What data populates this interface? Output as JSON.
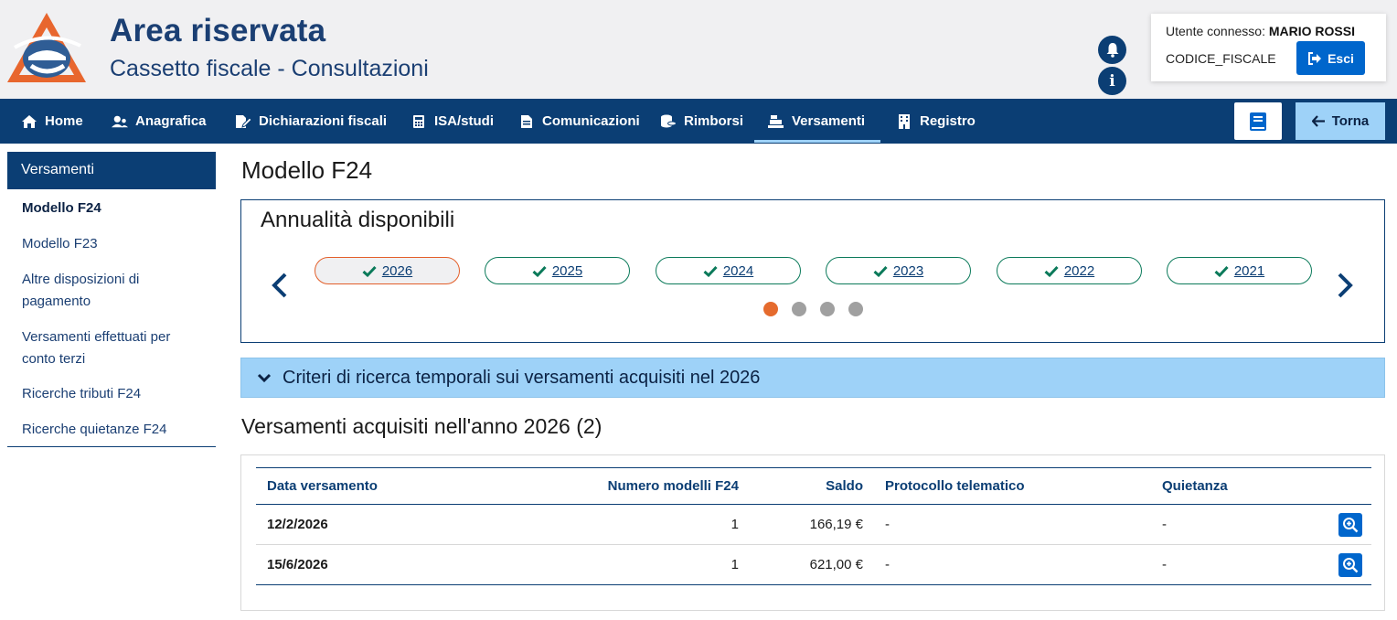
{
  "header": {
    "title": "Area riservata",
    "subtitle": "Cassetto fiscale - Consultazioni",
    "user_label": "Utente connesso:",
    "user_name": "MARIO ROSSI",
    "codice_fiscale": "CODICE_FISCALE",
    "logout_label": "Esci",
    "colors": {
      "brand_blue": "#0b3e74",
      "accent_orange": "#e35f2a",
      "button_blue": "#0066cc"
    }
  },
  "nav": {
    "items": [
      {
        "label": "Home",
        "icon": "home-icon"
      },
      {
        "label": "Anagrafica",
        "icon": "users-icon"
      },
      {
        "label": "Dichiarazioni fiscali",
        "icon": "edit-document-icon"
      },
      {
        "label": "ISA/studi",
        "icon": "calculator-icon"
      },
      {
        "label": "Comunicazioni",
        "icon": "document-icon"
      },
      {
        "label": "Rimborsi",
        "icon": "coins-icon"
      },
      {
        "label": "Versamenti",
        "icon": "cash-register-icon",
        "active": true
      },
      {
        "label": "Registro",
        "icon": "building-icon"
      }
    ],
    "manual_icon": "book-icon",
    "back_label": "Torna"
  },
  "sidebar": {
    "heading": "Versamenti",
    "items": [
      {
        "label": "Modello F24",
        "active": true
      },
      {
        "label": "Modello F23"
      },
      {
        "label": "Altre disposizioni di pagamento"
      },
      {
        "label": "Versamenti effettuati per conto terzi"
      },
      {
        "label": "Ricerche tributi F24"
      },
      {
        "label": "Ricerche quietanze F24"
      }
    ]
  },
  "main": {
    "title": "Modello F24",
    "years_title": "Annualità disponibili",
    "years": [
      "2026",
      "2025",
      "2024",
      "2023",
      "2022",
      "2021"
    ],
    "selected_year": "2026",
    "carousel_pages": 4,
    "carousel_current": 1,
    "criteria_label": "Criteri di ricerca temporali sui versamenti acquisiti nel 2026",
    "section_title": "Versamenti acquisiti nell'anno 2026 (2)",
    "table": {
      "headers": [
        "Data versamento",
        "Numero modelli F24",
        "Saldo",
        "Protocollo telematico",
        "Quietanza"
      ],
      "rows": [
        {
          "date": "12/2/2026",
          "models": "1",
          "saldo": "166,19 €",
          "protocollo": "-",
          "quietanza": "-"
        },
        {
          "date": "15/6/2026",
          "models": "1",
          "saldo": "621,00 €",
          "protocollo": "-",
          "quietanza": "-"
        }
      ]
    }
  }
}
